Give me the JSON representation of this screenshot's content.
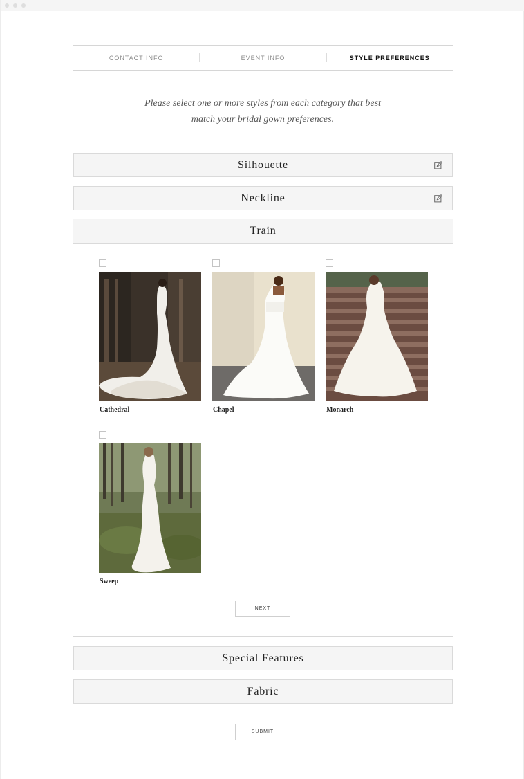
{
  "steps": [
    {
      "label": "CONTACT INFO",
      "active": false
    },
    {
      "label": "EVENT INFO",
      "active": false
    },
    {
      "label": "STYLE PREFERENCES",
      "active": true
    }
  ],
  "intro": {
    "line1": "Please select one or more styles from each category that best",
    "line2": "match your bridal gown preferences."
  },
  "sections": {
    "silhouette": {
      "title": "Silhouette",
      "icon": "edit-icon"
    },
    "neckline": {
      "title": "Neckline",
      "icon": "edit-icon"
    },
    "train": {
      "title": "Train",
      "options": [
        {
          "label": "Cathedral",
          "checked": false
        },
        {
          "label": "Chapel",
          "checked": false
        },
        {
          "label": "Monarch",
          "checked": false
        },
        {
          "label": "Sweep",
          "checked": false
        }
      ],
      "next_label": "NEXT"
    },
    "special_features": {
      "title": "Special Features"
    },
    "fabric": {
      "title": "Fabric"
    }
  },
  "submit_label": "SUBMIT"
}
